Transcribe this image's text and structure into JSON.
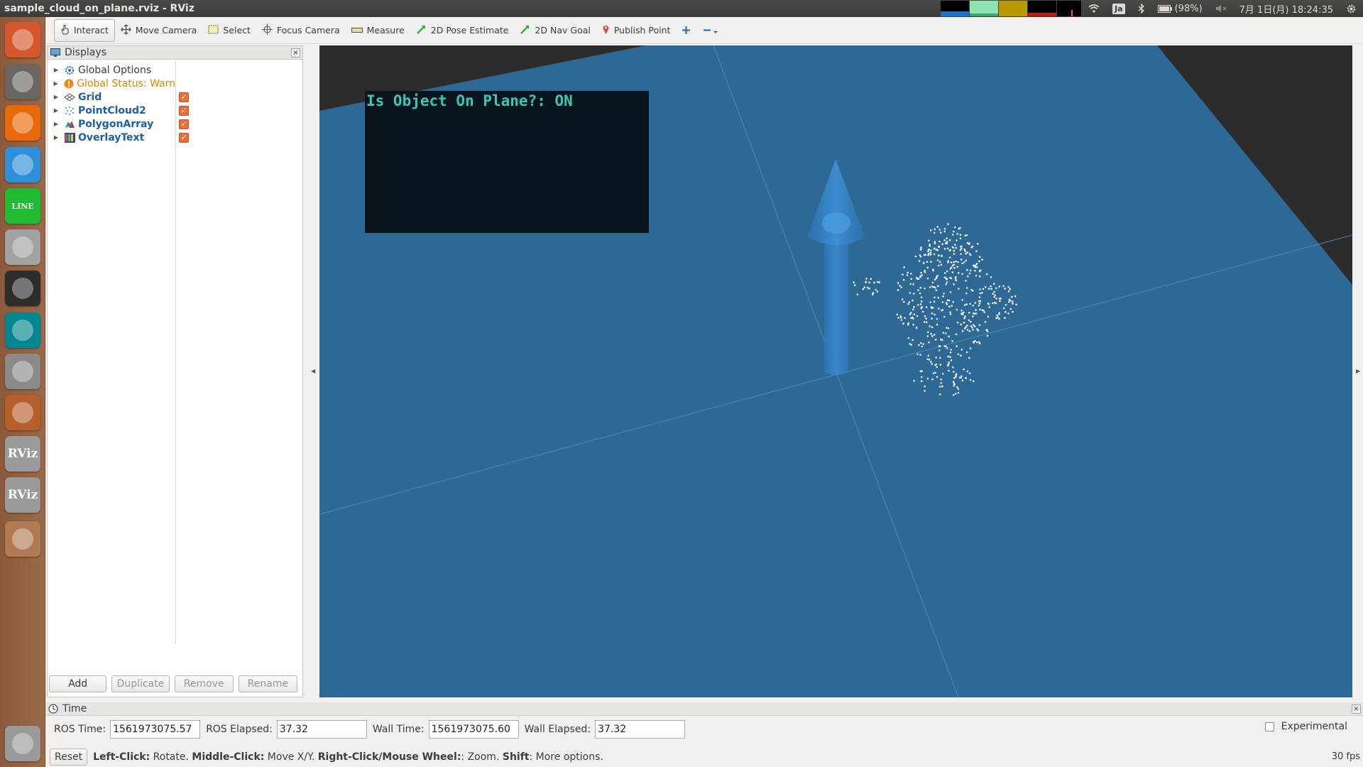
{
  "window": {
    "title": "sample_cloud_on_plane.rviz - RViz"
  },
  "system_tray": {
    "ime": "Ja",
    "battery": "(98%)",
    "clock": "7月 1日(月) 18:24:35"
  },
  "launcher": {
    "items": [
      {
        "name": "ubuntu-dash",
        "color": "#d8562c"
      },
      {
        "name": "files",
        "color": "#6a6661"
      },
      {
        "name": "firefox",
        "color": "#e8690a"
      },
      {
        "name": "chrome",
        "color": "#2f8ed8"
      },
      {
        "name": "line",
        "color": "#1fbc33",
        "label": "LINE"
      },
      {
        "name": "disks",
        "color": "#a2a2a2"
      },
      {
        "name": "terminal",
        "color": "#2d2d2d"
      },
      {
        "name": "arduino",
        "color": "#00878f"
      },
      {
        "name": "camera",
        "color": "#8a8a8a"
      },
      {
        "name": "settings",
        "color": "#b75e2d"
      },
      {
        "name": "rviz-1",
        "color": "#9a9a9a",
        "label": "RViz"
      },
      {
        "name": "rviz-2",
        "color": "#9a9a9a",
        "label": "RViz"
      },
      {
        "name": "workspaces",
        "color": "#b07a55"
      },
      {
        "name": "trash",
        "color": "#9a9a9a"
      }
    ]
  },
  "toolbar": {
    "tools": [
      {
        "id": "interact",
        "label": "Interact",
        "icon": "hand-icon",
        "active": true
      },
      {
        "id": "move-camera",
        "label": "Move Camera",
        "icon": "move-icon"
      },
      {
        "id": "select",
        "label": "Select",
        "icon": "select-rect-icon"
      },
      {
        "id": "focus-camera",
        "label": "Focus Camera",
        "icon": "crosshair-icon"
      },
      {
        "id": "measure",
        "label": "Measure",
        "icon": "ruler-icon"
      },
      {
        "id": "2d-pose-estimate",
        "label": "2D Pose Estimate",
        "icon": "green-arrow-icon"
      },
      {
        "id": "2d-nav-goal",
        "label": "2D Nav Goal",
        "icon": "green-arrow-icon"
      },
      {
        "id": "publish-point",
        "label": "Publish Point",
        "icon": "pin-icon"
      }
    ]
  },
  "displays_panel": {
    "title": "Displays",
    "items": [
      {
        "label": "Global Options",
        "style": "normal",
        "checked": null
      },
      {
        "label": "Global Status: Warn",
        "style": "warn",
        "checked": null
      },
      {
        "label": "Grid",
        "style": "blue",
        "checked": true
      },
      {
        "label": "PointCloud2",
        "style": "blue",
        "checked": true
      },
      {
        "label": "PolygonArray",
        "style": "blue",
        "checked": true
      },
      {
        "label": "OverlayText",
        "style": "blue",
        "checked": true
      }
    ],
    "buttons": {
      "add": "Add",
      "duplicate": "Duplicate",
      "remove": "Remove",
      "rename": "Rename"
    }
  },
  "view": {
    "overlay_text": "Is Object On Plane?: ON",
    "plane_color": "#2e6894",
    "background_color": "#2c2c2c"
  },
  "time_panel": {
    "title": "Time",
    "ros_time_label": "ROS Time:",
    "ros_time": "1561973075.57",
    "ros_elapsed_label": "ROS Elapsed:",
    "ros_elapsed": "37.32",
    "wall_time_label": "Wall Time:",
    "wall_time": "1561973075.60",
    "wall_elapsed_label": "Wall Elapsed:",
    "wall_elapsed": "37.32",
    "experimental_label": "Experimental"
  },
  "status_bar": {
    "reset": "Reset",
    "help_left_click": "Left-Click:",
    "help_rotate": " Rotate. ",
    "help_middle_click": "Middle-Click:",
    "help_move": " Move X/Y. ",
    "help_right_click": "Right-Click/Mouse Wheel:",
    "help_zoom": ": Zoom. ",
    "help_shift": "Shift",
    "help_more": ": More options.",
    "fps": "30 fps"
  }
}
